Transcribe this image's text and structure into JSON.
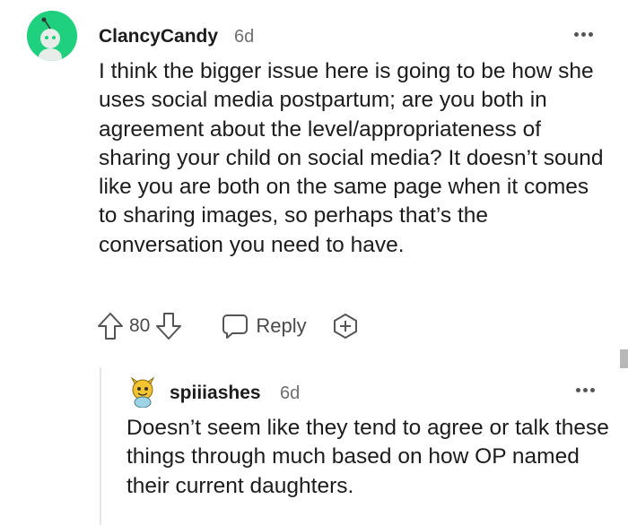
{
  "comment": {
    "username": "ClancyCandy",
    "age": "6d",
    "body": "I think the bigger issue here is going to be how she uses social media postpartum; are you both in agreement about the level/appropriateness of sharing your child on social media? It doesn’t sound like you are both on the same page when it comes to sharing images, so perhaps that’s the conversation you need to have.",
    "votes": "80",
    "reply_label": "Reply",
    "avatar_color": "#1fd07e",
    "icons": [
      "snoo-avatar-icon",
      "more-options-icon",
      "upvote-arrow-icon",
      "downvote-arrow-icon",
      "reply-bubble-icon",
      "award-plus-icon"
    ]
  },
  "reply": {
    "username": "spiiiashes",
    "age": "6d",
    "body": "Doesn’t seem like they tend to agree or talk these things through much based on how OP named their current daughters.",
    "icons": [
      "avatar-icon",
      "more-options-icon"
    ]
  }
}
